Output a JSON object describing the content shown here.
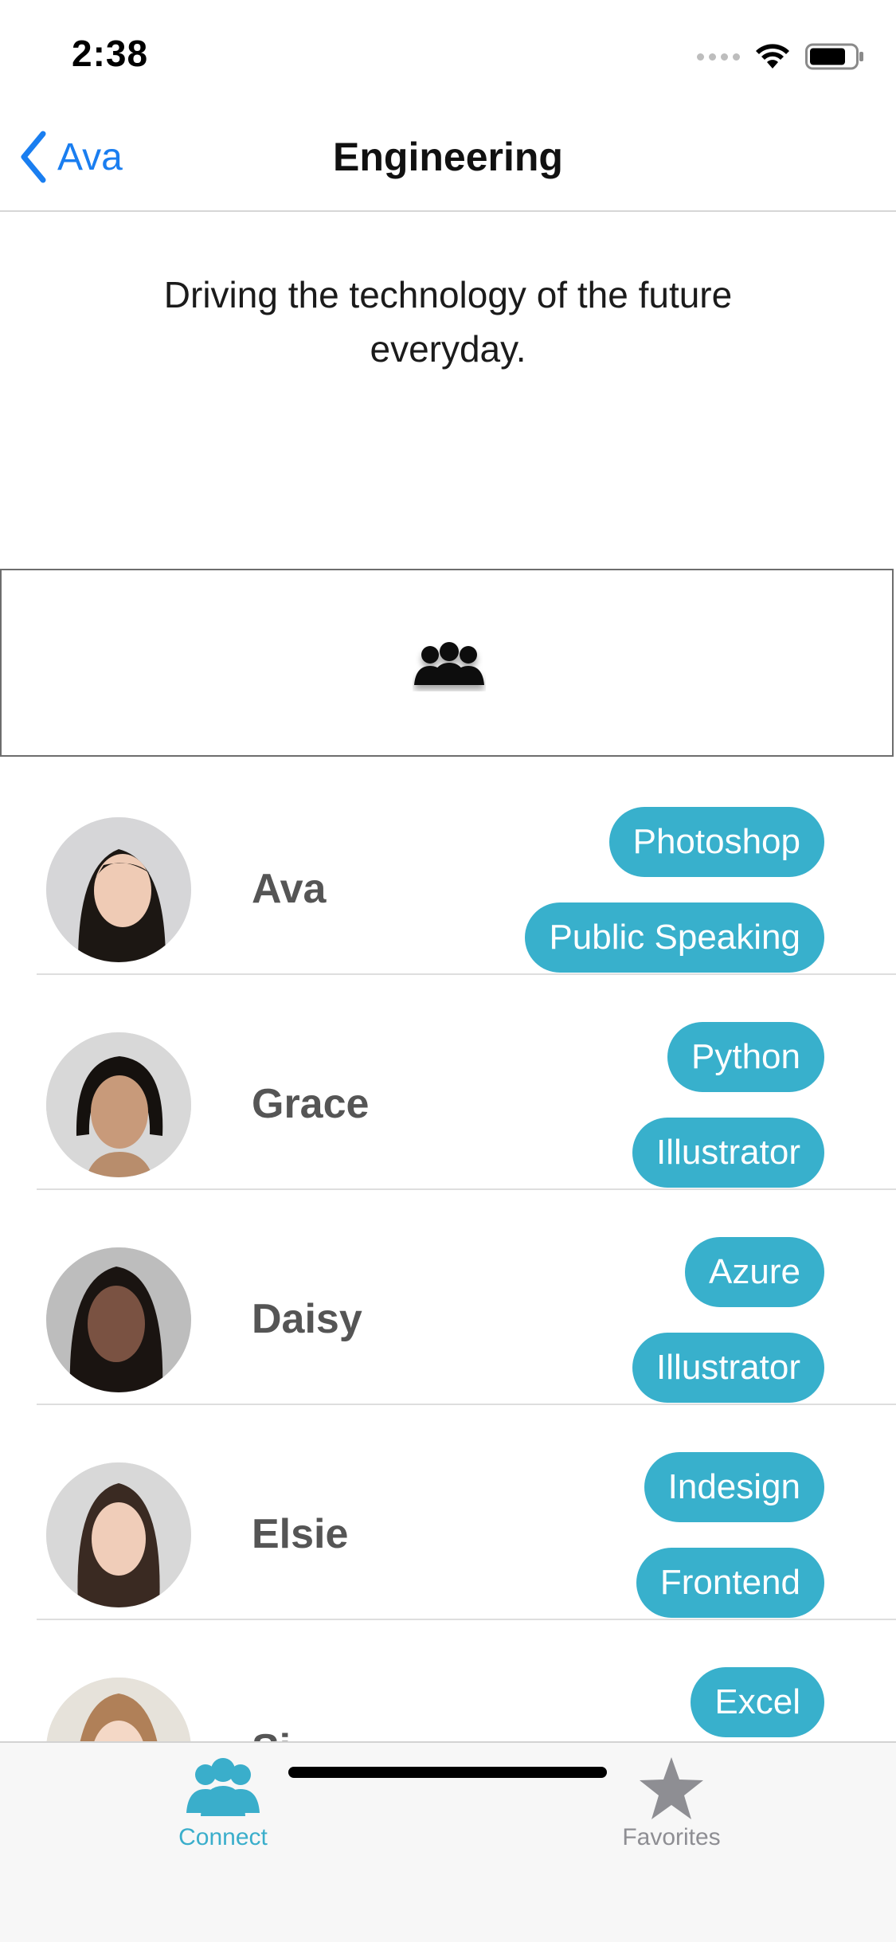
{
  "status_bar": {
    "time": "2:38",
    "icons": [
      "signal-dots-icon",
      "wifi-icon",
      "battery-icon"
    ]
  },
  "nav": {
    "back_label": "Ava",
    "title": "Engineering"
  },
  "group": {
    "description": "Driving the technology of the future everyday.",
    "banner_icon": "group-people-icon"
  },
  "members": [
    {
      "name": "Ava",
      "skills": [
        "Photoshop",
        "Public Speaking"
      ]
    },
    {
      "name": "Grace",
      "skills": [
        "Python",
        "Illustrator"
      ]
    },
    {
      "name": "Daisy",
      "skills": [
        "Azure",
        "Illustrator"
      ]
    },
    {
      "name": "Elsie",
      "skills": [
        "Indesign",
        "Frontend"
      ]
    },
    {
      "name": "Si",
      "skills": [
        "Excel"
      ]
    }
  ],
  "tab_bar": {
    "tabs": [
      {
        "label": "Connect",
        "icon": "people-icon",
        "selected": true
      },
      {
        "label": "Favorites",
        "icon": "star-icon",
        "selected": false
      }
    ]
  },
  "colors": {
    "accent": "#38b0cc",
    "back_link": "#1a7ef0",
    "tab_inactive": "#8e8e93"
  }
}
